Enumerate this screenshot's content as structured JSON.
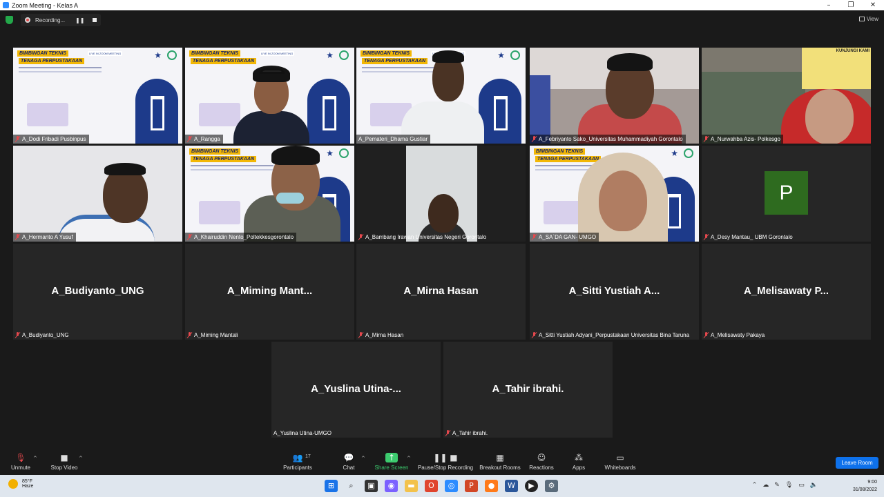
{
  "window": {
    "title": "Zoom Meeting - Kelas A",
    "minimize": "–",
    "maximize": "❐",
    "close": "✕"
  },
  "topbar": {
    "recording_label": "Recording...",
    "pause_icon": "❚❚",
    "view_label": "View"
  },
  "slide": {
    "line1": "BIMBINGAN TEKNIS",
    "line2": "TENAGA PERPUSTAKAAN",
    "zoom_tag": "LIVE IN ZOOM MEETING",
    "star": "★"
  },
  "participants_tiles": [
    {
      "name": "A_Dodi Fribadi Pusbinpus"
    },
    {
      "name": "A_Rangga"
    },
    {
      "name": "A_Pemateri_Dhama Gustiar"
    },
    {
      "name": "A_Febriyanto  Sako_Universitas Muhammadiyah Gorontalo"
    },
    {
      "name": "A_Nurwahba Azis-  Polkesgo"
    },
    {
      "name": "A_Hermanto A Yusuf"
    },
    {
      "name": "A_Khairuddin Nento_Poltekkesgorontalo"
    },
    {
      "name": "A_Bambang Irawan Universitas Negeri Gorontalo"
    },
    {
      "name": "A_SA`DA GAN- UMGO"
    },
    {
      "name": "A_Desy Mantau_ UBM Gorontalo",
      "avatar_letter": "P"
    },
    {
      "name": "A_Budiyanto_UNG",
      "display": "A_Budiyanto_UNG"
    },
    {
      "name": "A_Miming Mantali",
      "display": "A_Miming  Mant..."
    },
    {
      "name": "A_Mirna Hasan",
      "display": "A_Mirna Hasan"
    },
    {
      "name": "A_Sitti Yustiah Adyani_Perpustakaan Universitas Bina Taruna",
      "display": "A_Sitti  Yustiah A..."
    },
    {
      "name": "A_Melisawaty Pakaya",
      "display": "A_Melisawaty  P..."
    },
    {
      "name": "A_Yuslina Utina-UMGO",
      "display": "A_Yuslina  Utina-..."
    },
    {
      "name": "A_Tahir ibrahi.",
      "display": "A_Tahir ibrahi."
    }
  ],
  "background_sign": "KUNJUNGI KAMI",
  "toolbar": {
    "unmute": "Unmute",
    "stop_video": "Stop Video",
    "participants": "Participants",
    "participants_count": "17",
    "chat": "Chat",
    "share_screen": "Share Screen",
    "pause_stop_recording": "Pause/Stop Recording",
    "breakout_rooms": "Breakout Rooms",
    "reactions": "Reactions",
    "apps": "Apps",
    "whiteboards": "Whiteboards",
    "leave_room": "Leave Room",
    "caret": "^"
  },
  "taskbar": {
    "weather_temp": "85°F",
    "weather_desc": "Haze",
    "time": "9:00",
    "date": "31/08/2022"
  },
  "colors": {
    "accent": "#0e71eb",
    "active_speaker": "#e5e561",
    "muted": "#e5484d",
    "avatar_bg": "#2e6b1f",
    "share_green": "#3ccb6e"
  }
}
